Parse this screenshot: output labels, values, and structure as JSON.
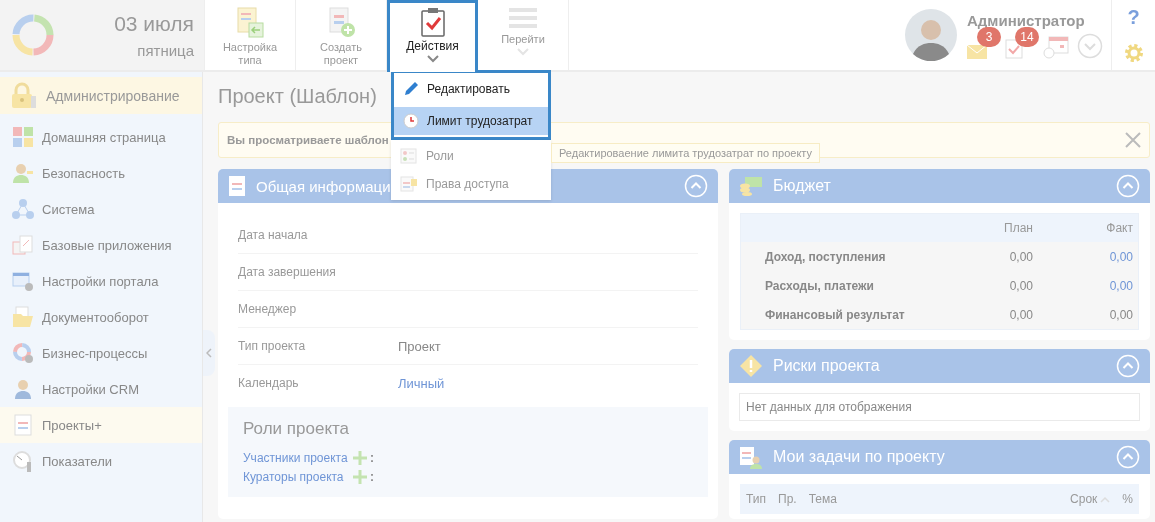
{
  "header": {
    "date": "03 июля",
    "weekday": "пятница",
    "toolbar": [
      {
        "label": "Настройка типа",
        "kind": "type-settings",
        "selected": false
      },
      {
        "label": "Создать проект",
        "kind": "create",
        "selected": false
      },
      {
        "label": "Действия",
        "kind": "actions",
        "selected": true
      },
      {
        "label": "Перейти",
        "kind": "goto",
        "selected": false
      }
    ],
    "user": {
      "name": "Администратор",
      "mail_count": "3",
      "task_count": "14"
    },
    "help": "?"
  },
  "sidebar": {
    "items": [
      {
        "label": "Администрирование",
        "kind": "lock",
        "selected": false,
        "group": true
      },
      {
        "label": "Домашняя страница",
        "kind": "tiles",
        "selected": false,
        "group": false
      },
      {
        "label": "Безопасность",
        "kind": "person-key",
        "selected": false,
        "group": false
      },
      {
        "label": "Система",
        "kind": "network",
        "selected": false,
        "group": false
      },
      {
        "label": "Базовые приложения",
        "kind": "calendar",
        "selected": false,
        "group": false
      },
      {
        "label": "Настройки портала",
        "kind": "table-gear",
        "selected": false,
        "group": false
      },
      {
        "label": "Документооборот",
        "kind": "folder",
        "selected": false,
        "group": false
      },
      {
        "label": "Бизнес-процессы",
        "kind": "ring-gear",
        "selected": false,
        "group": false
      },
      {
        "label": "Настройки CRM",
        "kind": "person",
        "selected": false,
        "group": false
      },
      {
        "label": "Проекты+",
        "kind": "doc",
        "selected": true,
        "group": false
      },
      {
        "label": "Показатели",
        "kind": "gauge",
        "selected": false,
        "group": false
      }
    ]
  },
  "page": {
    "title": "Проект (Шаблон)"
  },
  "notice": {
    "text": "Вы просматриваете шаблон"
  },
  "actions_menu": {
    "items": [
      {
        "label": "Редактировать",
        "kind": "pencil",
        "selected": false,
        "dimmed": false
      },
      {
        "label": "Лимит трудозатрат",
        "kind": "clock",
        "selected": true,
        "dimmed": false
      },
      {
        "label": "Роли",
        "kind": "roles",
        "selected": false,
        "dimmed": true
      },
      {
        "label": "Права доступа",
        "kind": "access",
        "selected": false,
        "dimmed": true
      }
    ]
  },
  "tooltip": "Редактироваение лимита трудозатрат по проекту",
  "general": {
    "title": "Общая информаци",
    "fields": [
      {
        "label": "Дата начала"
      },
      {
        "label": "Дата завершения"
      },
      {
        "label": "Менеджер"
      },
      {
        "label": "Тип проекта",
        "value": "Проект",
        "kind": "plain"
      },
      {
        "label": "Календарь",
        "value": "Личный",
        "kind": "link"
      }
    ],
    "roles": {
      "title": "Роли проекта",
      "items": [
        {
          "label": "Участники проекта",
          "suffix": ":"
        },
        {
          "label": "Кураторы проекта",
          "suffix": ":"
        }
      ]
    }
  },
  "budget": {
    "title": "Бюджет",
    "columns": [
      "План",
      "Факт"
    ],
    "rows": [
      {
        "label": "Доход, поступления",
        "plan": "0,00",
        "fact": "0,00",
        "fact_link": true
      },
      {
        "label": "Расходы, платежи",
        "plan": "0,00",
        "fact": "0,00",
        "fact_link": true
      },
      {
        "label": "Финансовый результат",
        "plan": "0,00",
        "fact": "0,00",
        "fact_link": false
      }
    ]
  },
  "risks": {
    "title": "Риски проекта",
    "empty_text": "Нет данных для отображения"
  },
  "tasks": {
    "title": "Мои задачи по проекту",
    "columns": [
      {
        "label": "Тип",
        "sorted": false
      },
      {
        "label": "Пр.",
        "sorted": false
      },
      {
        "label": "Тема",
        "sorted": false
      },
      {
        "label": "Срок",
        "sorted": true
      },
      {
        "label": "%",
        "sorted": false
      }
    ]
  }
}
